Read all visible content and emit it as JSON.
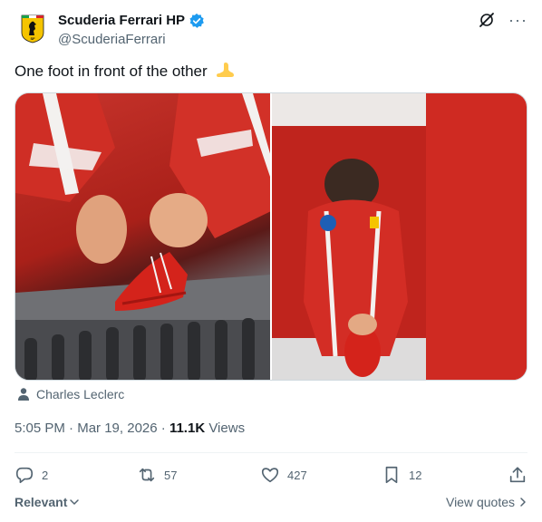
{
  "tweet": {
    "author": {
      "display_name": "Scuderia Ferrari HP",
      "handle": "@ScuderiaFerrari",
      "verified": true,
      "avatar_icon": "ferrari-shield-logo"
    },
    "text": "One foot in front of the other",
    "emoji": "foot",
    "media": [
      {
        "description_icon": "photo",
        "index": 1
      },
      {
        "description_icon": "photo",
        "index": 2
      }
    ],
    "tagged_user": "Charles Leclerc",
    "meta": {
      "time": "5:05 PM",
      "separator": "·",
      "date": "Mar 19, 2026",
      "views_count": "11.1K",
      "views_label": "Views"
    },
    "actions": {
      "replies": "2",
      "reposts": "57",
      "likes": "427",
      "bookmarks": "12"
    },
    "footer": {
      "sort_label": "Relevant",
      "view_quotes_label": "View quotes"
    }
  },
  "colors": {
    "accent": "#1d9bf0",
    "text": "#0f1419",
    "muted": "#536471",
    "ferrari_yellow": "#f5c400",
    "ferrari_red": "#c8342c"
  }
}
